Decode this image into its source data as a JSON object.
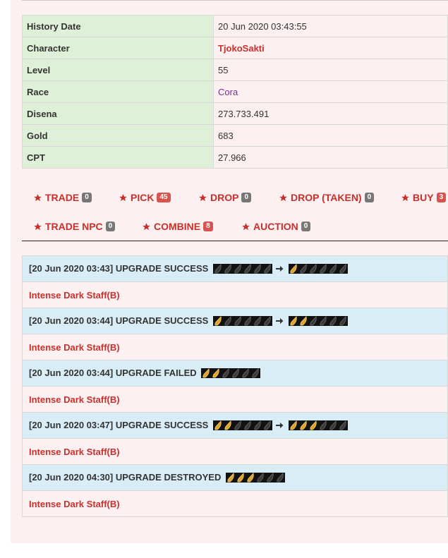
{
  "info": [
    {
      "key": "History Date",
      "value": "20 Jun 2020 03:43:55"
    },
    {
      "key": "Character",
      "value": "TjokoSakti"
    },
    {
      "key": "Level",
      "value": "55"
    },
    {
      "key": "Race",
      "value": "Cora"
    },
    {
      "key": "Disena",
      "value": "273.733.491"
    },
    {
      "key": "Gold",
      "value": "683"
    },
    {
      "key": "CPT",
      "value": "27.966"
    }
  ],
  "filters": [
    {
      "label": "TRADE",
      "count": "0",
      "badge": "grey"
    },
    {
      "label": "PICK",
      "count": "45",
      "badge": "red"
    },
    {
      "label": "DROP",
      "count": "0",
      "badge": "grey"
    },
    {
      "label": "DROP (TAKEN)",
      "count": "0",
      "badge": "grey"
    },
    {
      "label": "BUY",
      "count": "3",
      "badge": "red"
    },
    {
      "label": "TRADE NPC",
      "count": "0",
      "badge": "grey"
    },
    {
      "label": "COMBINE",
      "count": "8",
      "badge": "red"
    },
    {
      "label": "AUCTION",
      "count": "0",
      "badge": "grey"
    }
  ],
  "log": [
    {
      "text": "[20 Jun 2020 03:43] UPGRADE SUCCESS",
      "from_level": 0,
      "to_level": 1,
      "item": "Intense Dark Staff(B)"
    },
    {
      "text": "[20 Jun 2020 03:44] UPGRADE SUCCESS",
      "from_level": 1,
      "to_level": 2,
      "item": "Intense Dark Staff(B)"
    },
    {
      "text": "[20 Jun 2020 03:44] UPGRADE FAILED",
      "from_level": 2,
      "to_level": null,
      "item": "Intense Dark Staff(B)"
    },
    {
      "text": "[20 Jun 2020 03:47] UPGRADE SUCCESS",
      "from_level": 2,
      "to_level": 3,
      "item": "Intense Dark Staff(B)"
    },
    {
      "text": "[20 Jun 2020 04:30] UPGRADE DESTROYED",
      "from_level": 3,
      "to_level": null,
      "item": "Intense Dark Staff(B)"
    }
  ],
  "icons": {
    "filter": "star-icon",
    "upgrade_level": "flame-icon",
    "transition": "arrow-right-icon"
  },
  "colors": {
    "link": "#c9302c",
    "header_green": "#dff0d8",
    "event_blue": "#d9edf7",
    "panel_pink": "#fdf0f0"
  }
}
